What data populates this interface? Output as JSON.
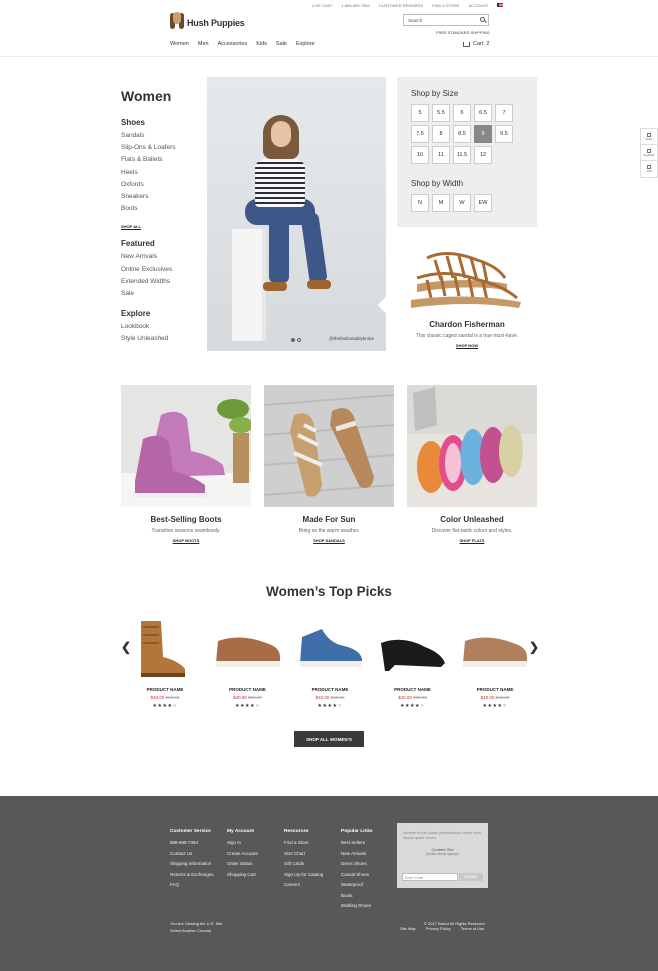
{
  "util_bar": {
    "live_chat": "LIVE CHAT",
    "phone": "1-866-699-7364",
    "customer_rewards": "CUSTOMER REWARDS",
    "find_store": "FIND A STORE",
    "account": "ACCOUNT"
  },
  "brand": {
    "name": "Hush Puppies"
  },
  "search": {
    "placeholder": "Search"
  },
  "free_shipping": "FREE STANDARD SHIPPING",
  "nav": [
    "Women",
    "Men",
    "Accessories",
    "Kids",
    "Sale",
    "Explore"
  ],
  "cart": {
    "label": "Cart",
    "count": "2"
  },
  "rail": [
    "Share",
    "Feedback",
    "Chat"
  ],
  "sidebar": {
    "title": "Women",
    "shoes_heading": "Shoes",
    "shoes": [
      "Sandals",
      "Slip-Ons & Loafers",
      "Flats & Ballets",
      "Heels",
      "Oxfords",
      "Sneakers",
      "Boots"
    ],
    "shop_all": "SHOP ALL",
    "featured_heading": "Featured",
    "featured": [
      "New Arrivals",
      "Online Exclusives",
      "Extended Widths",
      "Sale"
    ],
    "explore_heading": "Explore",
    "explore": [
      "Lookbook",
      "Style Unleashed"
    ]
  },
  "hero": {
    "handle": "@thefashionablybroke"
  },
  "size_panel": {
    "size_heading": "Shop by Size",
    "sizes": [
      "5",
      "5.5",
      "6",
      "6.5",
      "7",
      "7.5",
      "8",
      "8.5",
      "9",
      "9.5",
      "10",
      "11",
      "11.5",
      "12"
    ],
    "selected_size": "9",
    "width_heading": "Shop by Width",
    "widths": [
      "N",
      "M",
      "W",
      "EW"
    ]
  },
  "featured_product": {
    "name": "Chardon Fisherman",
    "desc": "This classic caged sandal is a true must-have.",
    "cta": "SHOP NOW"
  },
  "tiles": [
    {
      "title": "Best-Selling Boots",
      "desc": "Transition seasons seamlessly.",
      "cta": "SHOP BOOTS"
    },
    {
      "title": "Made For Sun",
      "desc": "Bring on the warm weather.",
      "cta": "SHOP SANDALS"
    },
    {
      "title": "Color Unleashed",
      "desc": "Discover flat-tastic colors and styles.",
      "cta": "SHOP FLATS"
    }
  ],
  "top_picks": {
    "title": "Women’s Top Picks",
    "products": [
      {
        "name": "PRODUCT NAME",
        "price": "$40.00",
        "was": "$60.00",
        "rating": 4
      },
      {
        "name": "PRODUCT NAME",
        "price": "$40.00",
        "was": "$60.00",
        "rating": 4
      },
      {
        "name": "PRODUCT NAME",
        "price": "$40.00",
        "was": "$60.00",
        "rating": 4
      },
      {
        "name": "PRODUCT NAME",
        "price": "$40.00",
        "was": "$60.00",
        "rating": 4
      },
      {
        "name": "PRODUCT NAME",
        "price": "$40.00",
        "was": "$60.00",
        "rating": 4
      }
    ],
    "cta": "SHOP ALL WOMEN’S"
  },
  "footer": {
    "customer_service": {
      "heading": "Customer Service",
      "links": [
        "866-699-7364",
        "Contact Us",
        "Shipping Information",
        "Returns & Exchanges",
        "FAQ"
      ]
    },
    "my_account": {
      "heading": "My Account",
      "links": [
        "Sign In",
        "Create Account",
        "Order Status",
        "Shopping Cart"
      ]
    },
    "resources": {
      "heading": "Resources",
      "links": [
        "Find a Store",
        "Size Chart",
        "Gift Cards",
        "Sign Up for Catalog",
        "Careers"
      ]
    },
    "popular_links": {
      "heading": "Popular Links",
      "links": [
        "Best Sellers",
        "New Arrivals",
        "Dress Shoes",
        "Casual Shoes",
        "Waterproof",
        "Boots",
        "Walking Shoes"
      ]
    },
    "promo": {
      "text": "Aenean eu tsd quam pellentesque ornare sem lacinia quam venen.",
      "slot": "Content Slot",
      "slot_sub": "(footer-email-signup)",
      "email_placeholder": "Enter Email",
      "submit": "SUBMIT"
    },
    "country_line1": "You Are Viewing the U.S. Site",
    "country_line2": "Select Another Country",
    "copyright": "© 2017 Brand All Rights Reserved",
    "bottom_links": [
      "Site Map",
      "Privacy Policy",
      "Terms of Use"
    ]
  },
  "colors": {
    "sale_red": "#c0392b",
    "footer_bg": "#58585a",
    "selected_size": "#888888"
  }
}
